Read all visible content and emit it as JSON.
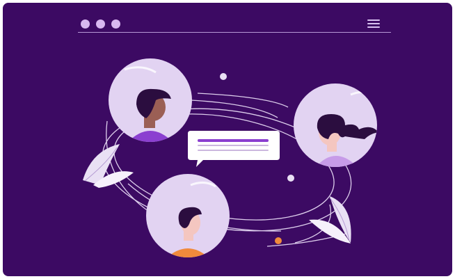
{
  "window": {
    "controls": [
      "dot-1",
      "dot-2",
      "dot-3"
    ],
    "menu_icon": "hamburger-menu-icon"
  },
  "illustration": {
    "avatars": [
      {
        "name": "avatar-man-top-left",
        "hair": "#2b0d3f",
        "skin": "#9b5f55",
        "shirt": "#8b3fd0"
      },
      {
        "name": "avatar-woman-right",
        "hair": "#2b0d3f",
        "skin": "#f4c6c0",
        "shirt": "#c79be8"
      },
      {
        "name": "avatar-man-bottom",
        "hair": "#2b0d3f",
        "skin": "#f4c6c0",
        "shirt": "#f08a3c"
      }
    ],
    "message_bubble_icon": "chat-bubble-icon",
    "leaf_icons": [
      "leaf-icon-left",
      "leaf-icon-right"
    ],
    "colors": {
      "background": "#3c0a63",
      "circle_fill": "#e2d3f2",
      "accent": "#8b3fd0",
      "orange_dot": "#f08a3c"
    }
  }
}
